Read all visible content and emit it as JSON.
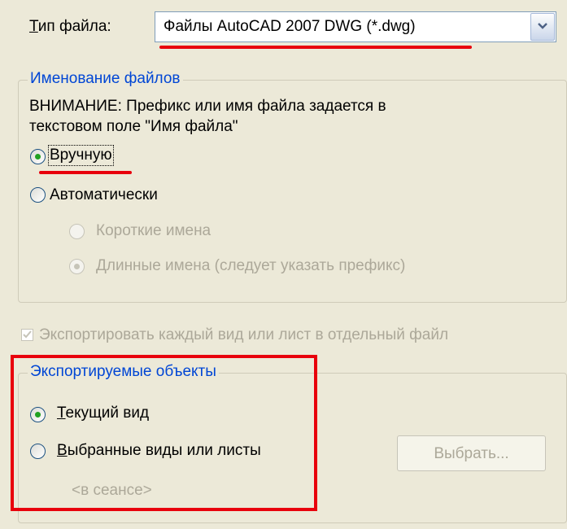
{
  "file_type": {
    "label_u": "Т",
    "label_rest": "ип файла:",
    "value": "Файлы AutoCAD 2007 DWG (*.dwg)"
  },
  "naming": {
    "title": "Именование файлов",
    "notice_line1": "ВНИМАНИЕ: Префикс или имя файла задается в",
    "notice_line2": "текстовом поле \"Имя файла\"",
    "manual": "Вручную",
    "manual_selected": true,
    "auto": "Автоматически",
    "short_names": "Короткие имена",
    "long_names": "Длинные имена (следует указать префикс)"
  },
  "export_each": {
    "label": "Экспортировать каждый вид или лист в отдельный файл",
    "checked": true
  },
  "exported_objects": {
    "title": "Экспортируемые объекты",
    "current_u": "Т",
    "current_rest": "екущий вид",
    "selected_u": "В",
    "selected_rest": "ыбранные виды или листы",
    "select_button": "Выбрать...",
    "session": "<в сеансе>"
  },
  "colors": {
    "background": "#ece9d8",
    "group_title": "#0046d5",
    "annotation_red": "#e8000c",
    "radio_dot": "#21a121"
  }
}
